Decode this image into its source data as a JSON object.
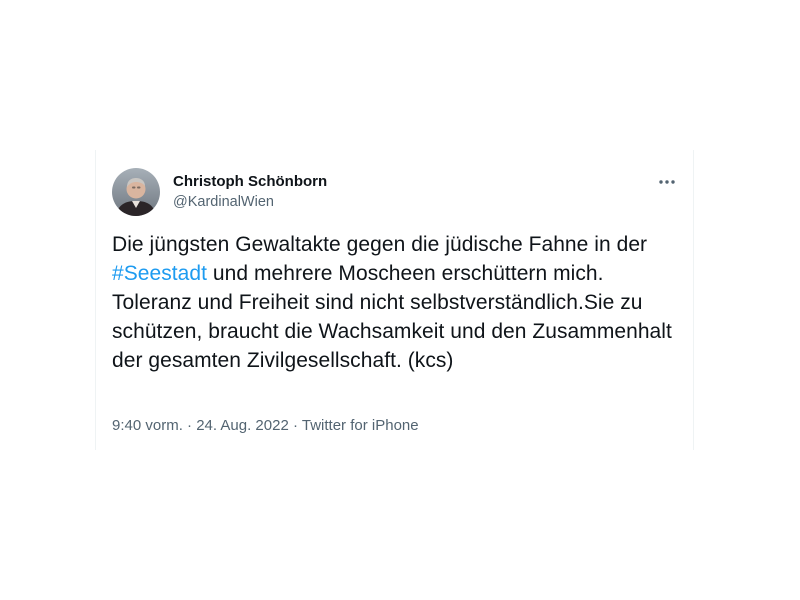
{
  "tweet": {
    "author": {
      "name": "Christoph Schönborn",
      "handle": "@KardinalWien"
    },
    "text": {
      "part1": "Die jüngsten Gewaltakte gegen die jüdische Fahne in der ",
      "hashtag": "#Seestadt",
      "part2": " und mehrere Moscheen erschüttern mich. Toleranz und Freiheit sind nicht selbstverständlich.Sie zu schützen, braucht die Wachsamkeit und den Zusammenhalt der gesamten Zivilgesellschaft. (kcs)"
    },
    "meta": {
      "time": "9:40 vorm.",
      "separator1": " · ",
      "date": "24. Aug. 2022",
      "separator2": " · ",
      "source": "Twitter for iPhone"
    },
    "more_icon": "more-horizontal-icon",
    "colors": {
      "hashtag": "#1d9bf0",
      "text": "#0f1419",
      "secondary": "#536471"
    }
  }
}
